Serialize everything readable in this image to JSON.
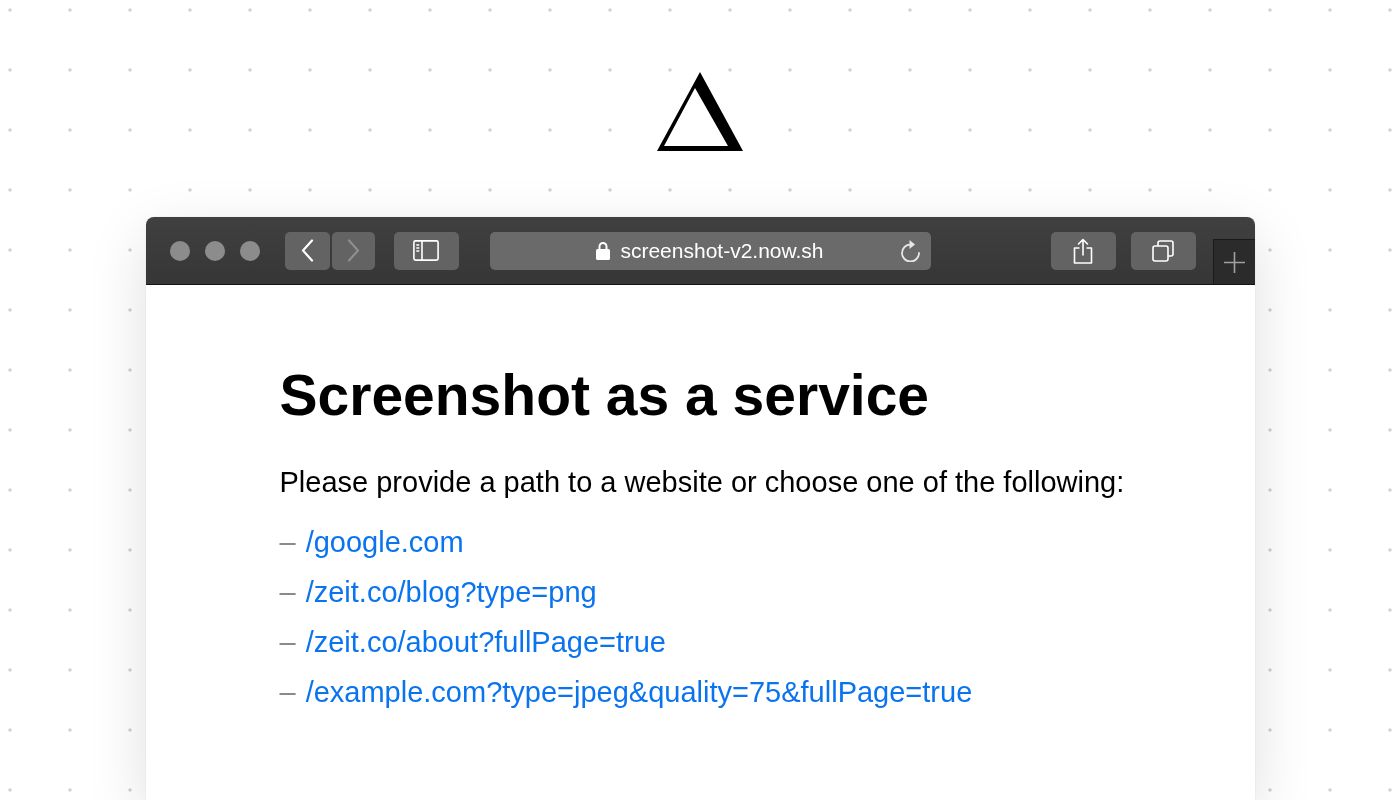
{
  "browser_window": {
    "toolbar": {
      "nav_buttons": [
        {
          "kind": "back",
          "disabled": false
        },
        {
          "kind": "forward",
          "disabled": true
        }
      ],
      "address_bar": {
        "url": "screenshot-v2.now.sh"
      }
    },
    "page": {
      "heading": "Screenshot as a service",
      "intro": "Please provide a path to a website or choose one of the following:",
      "links": [
        {
          "marker": "–",
          "text": "/google.com"
        },
        {
          "marker": "–",
          "text": "/zeit.co/blog?type=png"
        },
        {
          "marker": "–",
          "text": "/zeit.co/about?fullPage=true"
        },
        {
          "marker": "–",
          "text": "/example.com?type=jpeg&quality=75&fullPage=true"
        }
      ]
    }
  }
}
